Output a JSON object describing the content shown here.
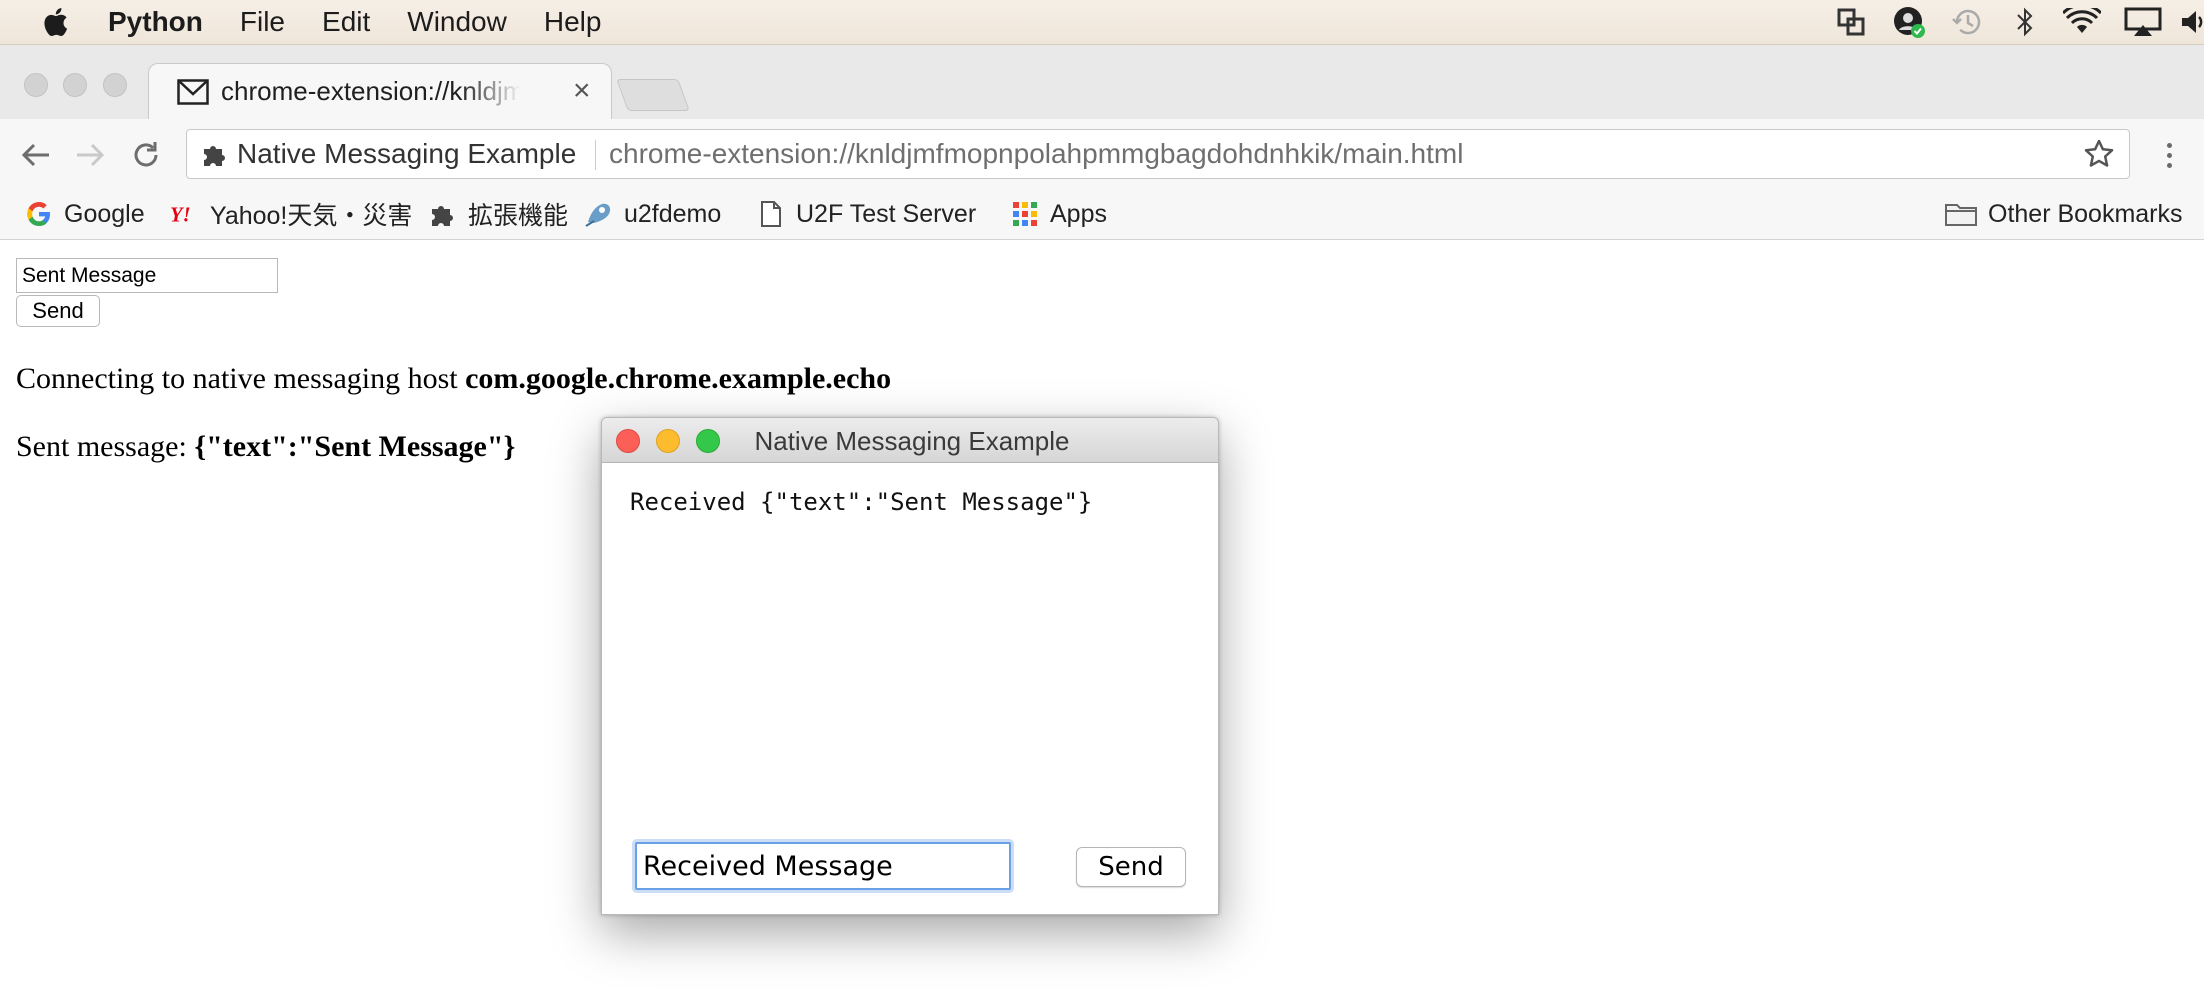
{
  "menubar": {
    "app_name": "Python",
    "items": [
      "File",
      "Edit",
      "Window",
      "Help"
    ],
    "status_icons": [
      "window-switch-icon",
      "profile-check-icon",
      "time-machine-icon",
      "bluetooth-icon",
      "wifi-icon",
      "airplay-icon",
      "volume-icon"
    ]
  },
  "browser": {
    "tab_title": "chrome-extension://knldjmfmopnpolahpmmgbagdohdnhkik/main.html",
    "tab_close": "×",
    "omnibox_chip": "Native Messaging Example",
    "url": "chrome-extension://knldjmfmopnpolahpmmgbagdohdnhkik/main.html",
    "bookmarks": [
      {
        "label": "Google",
        "icon": "google-icon"
      },
      {
        "label": "Yahoo!天気・災害",
        "icon": "yahoo-icon"
      },
      {
        "label": "拡張機能",
        "icon": "puzzle-icon"
      },
      {
        "label": "u2fdemo",
        "icon": "u2f-icon"
      },
      {
        "label": "U2F Test Server",
        "icon": "page-icon"
      },
      {
        "label": "Apps",
        "icon": "apps-grid-icon"
      }
    ],
    "other_bookmarks": "Other Bookmarks"
  },
  "page": {
    "input_value": "Sent Message",
    "send_label": "Send",
    "line1_prefix": "Connecting to native messaging host ",
    "line1_host": "com.google.chrome.example.echo",
    "line2_prefix": "Sent message: ",
    "line2_payload": "{\"text\":\"Sent Message\"}"
  },
  "dialog": {
    "title": "Native Messaging Example",
    "log_text": "Received {\"text\":\"Sent Message\"}",
    "input_value": "Received Message",
    "send_label": "Send"
  },
  "colors": {
    "close": "#fc5f57",
    "minimize": "#fdbc2e",
    "zoom": "#34c84a",
    "focus_ring": "#6aa0e6"
  }
}
